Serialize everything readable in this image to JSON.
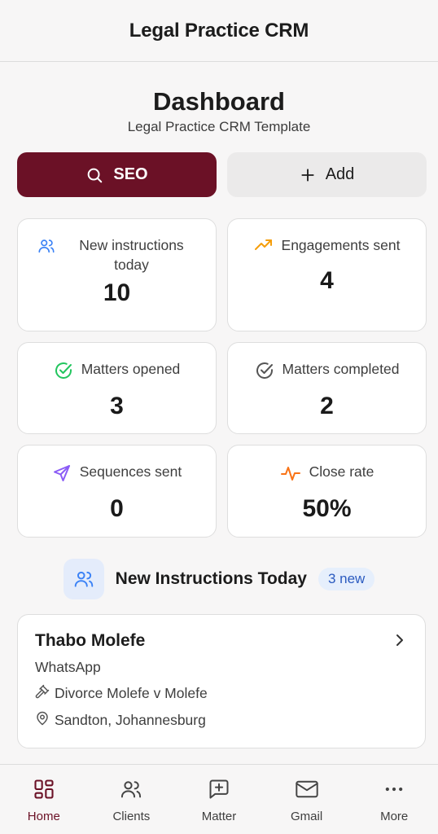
{
  "app": {
    "title": "Legal Practice CRM"
  },
  "header": {
    "title": "Dashboard",
    "subtitle": "Legal Practice CRM Template"
  },
  "actions": {
    "seo_label": "SEO",
    "add_label": "Add"
  },
  "stats": [
    {
      "label": "New instructions today",
      "value": "10",
      "icon": "users-icon",
      "color": "#3b82f6"
    },
    {
      "label": "Engagements sent",
      "value": "4",
      "icon": "trending-up-icon",
      "color": "#f59e0b"
    },
    {
      "label": "Matters opened",
      "value": "3",
      "icon": "check-circle-icon",
      "color": "#22c55e"
    },
    {
      "label": "Matters completed",
      "value": "2",
      "icon": "check-circle-icon",
      "color": "#555555"
    },
    {
      "label": "Sequences sent",
      "value": "0",
      "icon": "send-icon",
      "color": "#8b5cf6"
    },
    {
      "label": "Close rate",
      "value": "50%",
      "icon": "activity-icon",
      "color": "#f97316"
    }
  ],
  "section": {
    "title": "New Instructions Today",
    "badge": "3 new"
  },
  "instruction": {
    "name": "Thabo Molefe",
    "channel": "WhatsApp",
    "matter": "Divorce Molefe v Molefe",
    "location": "Sandton, Johannesburg"
  },
  "nav": [
    {
      "label": "Home",
      "icon": "grid-icon",
      "active": true
    },
    {
      "label": "Clients",
      "icon": "users-icon"
    },
    {
      "label": "Matter",
      "icon": "message-plus-icon"
    },
    {
      "label": "Gmail",
      "icon": "mail-icon"
    },
    {
      "label": "More",
      "icon": "more-icon"
    }
  ],
  "colors": {
    "brand": "#6b1126",
    "accent_blue": "#2b5bc0"
  }
}
